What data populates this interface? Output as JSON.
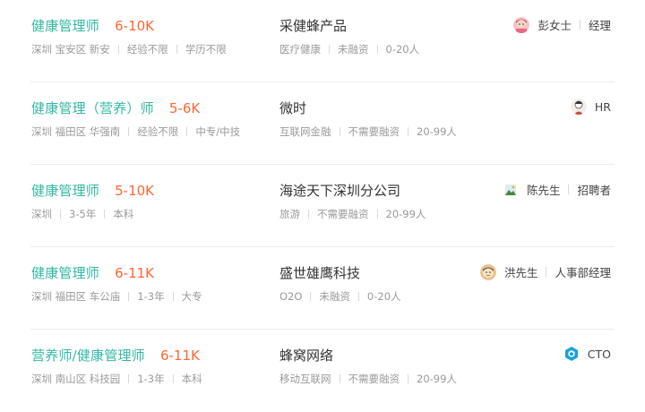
{
  "jobs": [
    {
      "title": "健康管理师",
      "salary": "6-10K",
      "meta": [
        "深圳 宝安区 新安",
        "经验不限",
        "学历不限"
      ],
      "company": "采健蜂产品",
      "company_meta": [
        "医疗健康",
        "未融资",
        "0-20人"
      ],
      "recruiter_name": "彭女士",
      "recruiter_title": "经理",
      "avatar_icon": "female-cartoon-avatar-icon",
      "avatar_color": "#f4a0a8"
    },
    {
      "title": "健康管理（营养）师",
      "salary": "5-6K",
      "meta": [
        "深圳 福田区 华强南",
        "经验不限",
        "中专/中技"
      ],
      "company": "微时",
      "company_meta": [
        "互联网金融",
        "不需要融资",
        "20-99人"
      ],
      "recruiter_name": "HR",
      "recruiter_title": "",
      "avatar_icon": "sketch-person-avatar-icon",
      "avatar_color": "#e8e4df"
    },
    {
      "title": "健康管理师",
      "salary": "5-10K",
      "meta": [
        "深圳",
        "3-5年",
        "本科"
      ],
      "company": "海途天下深圳分公司",
      "company_meta": [
        "旅游",
        "不需要融资",
        "20-99人"
      ],
      "recruiter_name": "陈先生",
      "recruiter_title": "招聘者",
      "avatar_icon": "landscape-avatar-icon",
      "avatar_color": "#7fb7d9"
    },
    {
      "title": "健康管理师",
      "salary": "6-11K",
      "meta": [
        "深圳 福田区 车公庙",
        "1-3年",
        "大专"
      ],
      "company": "盛世雄鹰科技",
      "company_meta": [
        "O2O",
        "未融资",
        "0-20人"
      ],
      "recruiter_name": "洪先生",
      "recruiter_title": "人事部经理",
      "avatar_icon": "male-cartoon-avatar-icon",
      "avatar_color": "#e6c08a"
    },
    {
      "title": "营养师/健康管理师",
      "salary": "6-11K",
      "meta": [
        "深圳 南山区 科技园",
        "1-3年",
        "本科"
      ],
      "company": "蜂窝网络",
      "company_meta": [
        "移动互联网",
        "不需要融资",
        "20-99人"
      ],
      "recruiter_name": "CTO",
      "recruiter_title": "",
      "avatar_icon": "hexagon-logo-avatar-icon",
      "avatar_color": "#1aa3d6"
    }
  ]
}
